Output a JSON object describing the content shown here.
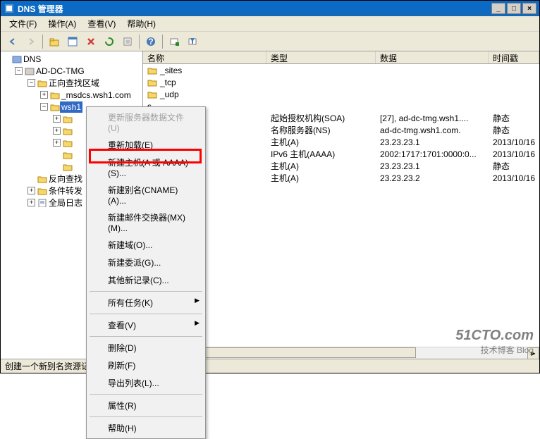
{
  "window": {
    "title": "DNS 管理器",
    "minimize": "_",
    "maximize": "□",
    "close": "×"
  },
  "menubar": {
    "file": "文件(F)",
    "action": "操作(A)",
    "view": "查看(V)",
    "help": "帮助(H)"
  },
  "tree": {
    "root": "DNS",
    "server": "AD-DC-TMG",
    "forward": "正向查找区域",
    "zone_msdcs": "_msdcs.wsh1.com",
    "zone_wsh1": "wsh1",
    "reverse": "反向查找",
    "conditional": "条件转发",
    "globallog": "全局日志"
  },
  "list": {
    "headers": {
      "name": "名称",
      "type": "类型",
      "data": "数据",
      "timestamp": "时间戳"
    },
    "rows": [
      {
        "name": "_sites",
        "type": "",
        "data": "",
        "ts": "",
        "icon": "folder"
      },
      {
        "name": "_tcp",
        "type": "",
        "data": "",
        "ts": "",
        "icon": "folder"
      },
      {
        "name": "_udp",
        "type": "",
        "data": "",
        "ts": "",
        "icon": "folder"
      },
      {
        "name": "s",
        "type": "",
        "data": "",
        "ts": "",
        "icon": "partial"
      },
      {
        "name": "同)",
        "type": "起始授权机构(SOA)",
        "data": "[27], ad-dc-tmg.wsh1....",
        "ts": "静态",
        "icon": "partial"
      },
      {
        "name": "同)",
        "type": "名称服务器(NS)",
        "data": "ad-dc-tmg.wsh1.com.",
        "ts": "静态",
        "icon": "partial"
      },
      {
        "name": "",
        "type": "主机(A)",
        "data": "23.23.23.1",
        "ts": "2013/10/16",
        "icon": "partial"
      },
      {
        "name": "",
        "type": "IPv6 主机(AAAA)",
        "data": "2002:1717:1701:0000:0...",
        "ts": "2013/10/16",
        "icon": "partial"
      },
      {
        "name": "",
        "type": "主机(A)",
        "data": "23.23.23.1",
        "ts": "静态",
        "icon": "partial"
      },
      {
        "name": "",
        "type": "主机(A)",
        "data": "23.23.23.2",
        "ts": "2013/10/16",
        "icon": "partial"
      }
    ]
  },
  "contextmenu": {
    "update_server_data": "更新服务器数据文件(U)",
    "reload": "重新加载(E)",
    "new_host": "新建主机(A 或 AAAA)(S)...",
    "new_cname": "新建别名(CNAME)(A)...",
    "new_mx": "新建邮件交换器(MX)(M)...",
    "new_domain": "新建域(O)...",
    "new_delegation": "新建委派(G)...",
    "other_new": "其他新记录(C)...",
    "all_tasks": "所有任务(K)",
    "view": "查看(V)",
    "delete": "删除(D)",
    "refresh": "刷新(F)",
    "export_list": "导出列表(L)...",
    "properties": "属性(R)",
    "help": "帮助(H)"
  },
  "statusbar": {
    "text": "创建一个新别名资源记录。"
  },
  "watermark": {
    "line1": "51CTO.com",
    "line2": "技术博客 Blog"
  }
}
